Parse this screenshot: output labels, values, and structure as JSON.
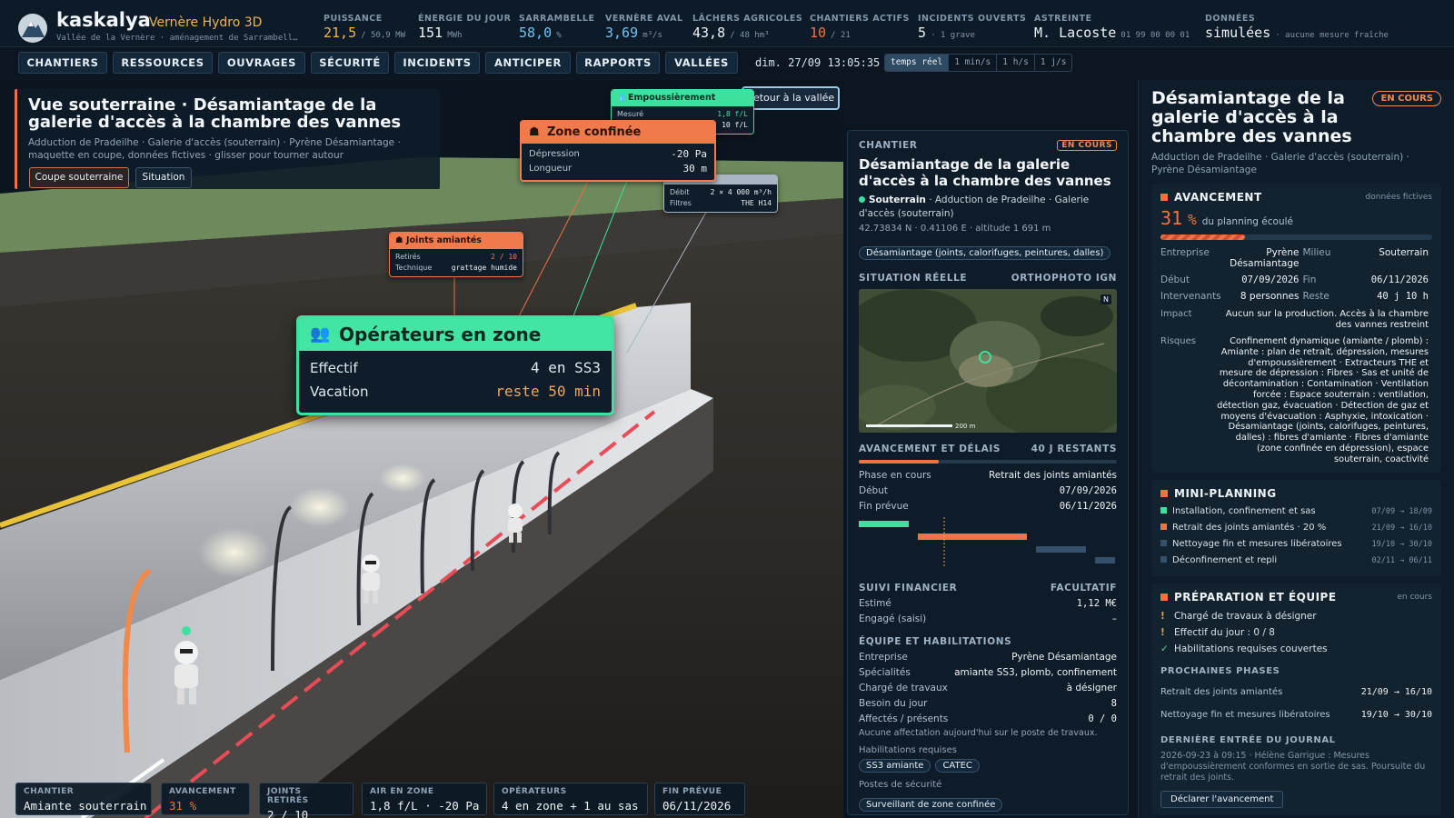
{
  "app": {
    "name": "kaskalya",
    "product": "Vernère Hydro 3D",
    "subtitle": "Vallée de la Vernère · aménagement de Sarrambell…"
  },
  "kpis": [
    {
      "label": "PUISSANCE",
      "value": "21,5",
      "unit": "/ 50,9 MW",
      "color": "#f0b354"
    },
    {
      "label": "ÉNERGIE DU JOUR",
      "value": "151",
      "unit": "MWh",
      "color": "#eef3f7"
    },
    {
      "label": "SARRAMBELLE",
      "value": "58,0",
      "unit": "%",
      "color": "#6ec3f2"
    },
    {
      "label": "VERNÈRE AVAL",
      "value": "3,69",
      "unit": "m³/s",
      "color": "#6ec3f2"
    },
    {
      "label": "LÂCHERS AGRICOLES",
      "value": "43,8",
      "unit": "/ 48 hm³",
      "color": "#eef3f7"
    },
    {
      "label": "CHANTIERS ACTIFS",
      "value": "10",
      "unit": "/ 21",
      "color": "#f0743f"
    },
    {
      "label": "INCIDENTS OUVERTS",
      "value": "5",
      "unit": "· 1 grave",
      "color": "#eef3f7"
    },
    {
      "label": "ASTREINTE",
      "value": "M. Lacoste",
      "unit": "01 99 00 00 01",
      "color": "#eef3f7"
    },
    {
      "label": "DONNÉES",
      "value": "simulées",
      "unit": "· aucune mesure fraîche",
      "color": "#eef3f7"
    }
  ],
  "nav": {
    "items": [
      "CHANTIERS",
      "RESSOURCES",
      "OUVRAGES",
      "SÉCURITÉ",
      "INCIDENTS",
      "ANTICIPER",
      "RAPPORTS",
      "VALLÉES"
    ],
    "datetime": "dim. 27/09 13:05:35",
    "speeds": [
      "temps réel",
      "1 min/s",
      "1 h/s",
      "1 j/s"
    ],
    "active_speed": "temps réel"
  },
  "scene": {
    "title": "Vue souterraine · Désamiantage de la galerie d'accès à la chambre des vannes",
    "description": "Adduction de Pradeilhe · Galerie d'accès (souterrain) · Pyrène Désamiantage · maquette en coupe, données fictives · glisser pour tourner autour",
    "btn_coupe": "Coupe souterraine",
    "btn_situation": "Situation",
    "btn_back": "Retour à la vallée",
    "tag_dust": {
      "title": "Empoussièrement",
      "rows": [
        {
          "k": "Mesuré",
          "v": "1,8 f/L"
        },
        {
          "k": "",
          "v": "10 f/L"
        }
      ]
    },
    "tag_zone": {
      "title": "Zone confinée",
      "rows": [
        {
          "k": "Dépression",
          "v": "-20 Pa"
        },
        {
          "k": "Longueur",
          "v": "30 m"
        }
      ]
    },
    "tag_extract": {
      "rows": [
        {
          "k": "Débit",
          "v": "2 × 4 000 m³/h"
        },
        {
          "k": "Filtres",
          "v": "THE H14"
        }
      ]
    },
    "tag_joints": {
      "title": "Joints amiantés",
      "rows": [
        {
          "k": "Retirés",
          "v": "2 / 10"
        },
        {
          "k": "Technique",
          "v": "grattage humide"
        }
      ]
    },
    "tag_ops": {
      "title": "Opérateurs en zone",
      "rows": [
        {
          "k": "Effectif",
          "v": "4 en SS3"
        },
        {
          "k": "Vacation",
          "v": "reste 50 min"
        }
      ]
    }
  },
  "bottom_strip": [
    {
      "label": "CHANTIER",
      "value": "Amiante souterrain",
      "color": "#eef3f7"
    },
    {
      "label": "AVANCEMENT",
      "value": "31 %",
      "color": "#f0743f"
    },
    {
      "label": "JOINTS RETIRÉS",
      "value": "2 / 10",
      "color": "#eef3f7"
    },
    {
      "label": "AIR EN ZONE",
      "value": "1,8 f/L · -20 Pa",
      "color": "#eef3f7"
    },
    {
      "label": "OPÉRATEURS",
      "value": "4 en zone + 1 au sas",
      "color": "#eef3f7"
    },
    {
      "label": "FIN PRÉVUE",
      "value": "06/11/2026",
      "color": "#eef3f7"
    }
  ],
  "mid": {
    "section": "CHANTIER",
    "status": "EN COURS",
    "title": "Désamiantage de la galerie d'accès à la chambre des vannes",
    "milieu": "Souterrain",
    "location_rest": " · Adduction de Pradeilhe · Galerie d'accès (souterrain)",
    "coords": "42.73834 N · 0.41106 E · altitude 1 691 m",
    "type_pill": "Désamiantage (joints, calorifuges, peintures, dalles)",
    "situation_label": "SITUATION RÉELLE",
    "ortho_label": "ORTHOPHOTO IGN",
    "map_scale": "200 m",
    "map_north": "N",
    "progress_label": "AVANCEMENT ET DÉLAIS",
    "remaining": "40 J RESTANTS",
    "progress_fraction": 0.31,
    "phase_k": "Phase en cours",
    "phase_v": "Retrait des joints amiantés",
    "start_k": "Début",
    "start_v": "07/09/2026",
    "end_k": "Fin prévue",
    "end_v": "06/11/2026",
    "fin_label": "SUIVI FINANCIER",
    "fin_opt": "FACULTATIF",
    "estimate_k": "Estimé",
    "estimate_v": "1,12 M€",
    "engaged_k": "Engagé (saisi)",
    "engaged_v": "–",
    "team_label": "ÉQUIPE ET HABILITATIONS",
    "team": [
      {
        "k": "Entreprise",
        "v": "Pyrène Désamiantage"
      },
      {
        "k": "Spécialités",
        "v": "amiante SS3, plomb, confinement"
      },
      {
        "k": "Chargé de travaux",
        "v": "à désigner"
      },
      {
        "k": "Besoin du jour",
        "v": "8"
      },
      {
        "k": "Affectés / présents",
        "v": "0 / 0"
      }
    ],
    "no_assign": "Aucune affectation aujourd'hui sur le poste de travaux.",
    "hab_label": "Habilitations requises",
    "habs": [
      "SS3 amiante",
      "CATEC"
    ],
    "posts_label": "Postes de sécurité",
    "posts": [
      "Surveillant de zone confinée"
    ]
  },
  "right": {
    "title": "Désamiantage de la galerie d'accès à la chambre des vannes",
    "status": "EN COURS",
    "subtitle": "Adduction de Pradeilhe · Galerie d'accès (souterrain) · Pyrène Désamiantage",
    "avancement_title": "AVANCEMENT",
    "fictive": "données fictives",
    "pct_value": "31",
    "pct_unit": "%",
    "pct_caption": "du planning écoulé",
    "progress_fraction": 0.31,
    "details": {
      "entreprise_k": "Entreprise",
      "entreprise_v": "Pyrène Désamiantage",
      "milieu_k": "Milieu",
      "milieu_v": "Souterrain",
      "debut_k": "Début",
      "debut_v": "07/09/2026",
      "fin_k": "Fin",
      "fin_v": "06/11/2026",
      "interv_k": "Intervenants",
      "interv_v": "8 personnes",
      "reste_k": "Reste",
      "reste_v": "40 j 10 h",
      "impact_k": "Impact",
      "impact_v": "Aucun sur la production. Accès à la chambre des vannes restreint",
      "risques_k": "Risques",
      "risques_v": "Confinement dynamique (amiante / plomb) : Amiante : plan de retrait, dépression, mesures d'empoussièrement · Extracteurs THE et mesure de dépression : Fibres · Sas et unité de décontamination : Contamination · Ventilation forcée : Espace souterrain : ventilation, détection gaz, évacuation · Détection de gaz et moyens d'évacuation : Asphyxie, intoxication · Désamiantage (joints, calorifuges, peintures, dalles) : fibres d'amiante · Fibres d'amiante (zone confinée en dépression), espace souterrain, coactivité"
    },
    "mini_title": "MINI-PLANNING",
    "mini": [
      {
        "label": "Installation, confinement et sas",
        "dates": "07/09 → 18/09",
        "color": "#3ee0a0"
      },
      {
        "label": "Retrait des joints amiantés · 20 %",
        "dates": "21/09 → 16/10",
        "color": "#f0743f"
      },
      {
        "label": "Nettoyage fin et mesures libératoires",
        "dates": "19/10 → 30/10",
        "color": "#35506a"
      },
      {
        "label": "Déconfinement et repli",
        "dates": "02/11 → 06/11",
        "color": "#35506a"
      }
    ],
    "prep_title": "PRÉPARATION ET ÉQUIPE",
    "prep_status": "en cours",
    "prep": [
      {
        "icon": "!",
        "text": "Chargé de travaux à désigner",
        "color": "#f0a030"
      },
      {
        "icon": "!",
        "text": "Effectif du jour : 0 / 8",
        "color": "#f0a030"
      },
      {
        "icon": "✓",
        "text": "Habilitations requises couvertes",
        "color": "#3ee0a0"
      }
    ],
    "next_title": "PROCHAINES PHASES",
    "next": [
      {
        "label": "Retrait des joints amiantés",
        "dates": "21/09 → 16/10"
      },
      {
        "label": "Nettoyage fin et mesures libératoires",
        "dates": "19/10 → 30/10"
      }
    ],
    "journal_title": "DERNIÈRE ENTRÉE DU JOURNAL",
    "journal_text": "2026-09-23 à 09:15 · Hélène Garrigue : Mesures d'empoussièrement conformes en sortie de sas. Poursuite du retrait des joints.",
    "declare_btn": "Déclarer l'avancement"
  }
}
